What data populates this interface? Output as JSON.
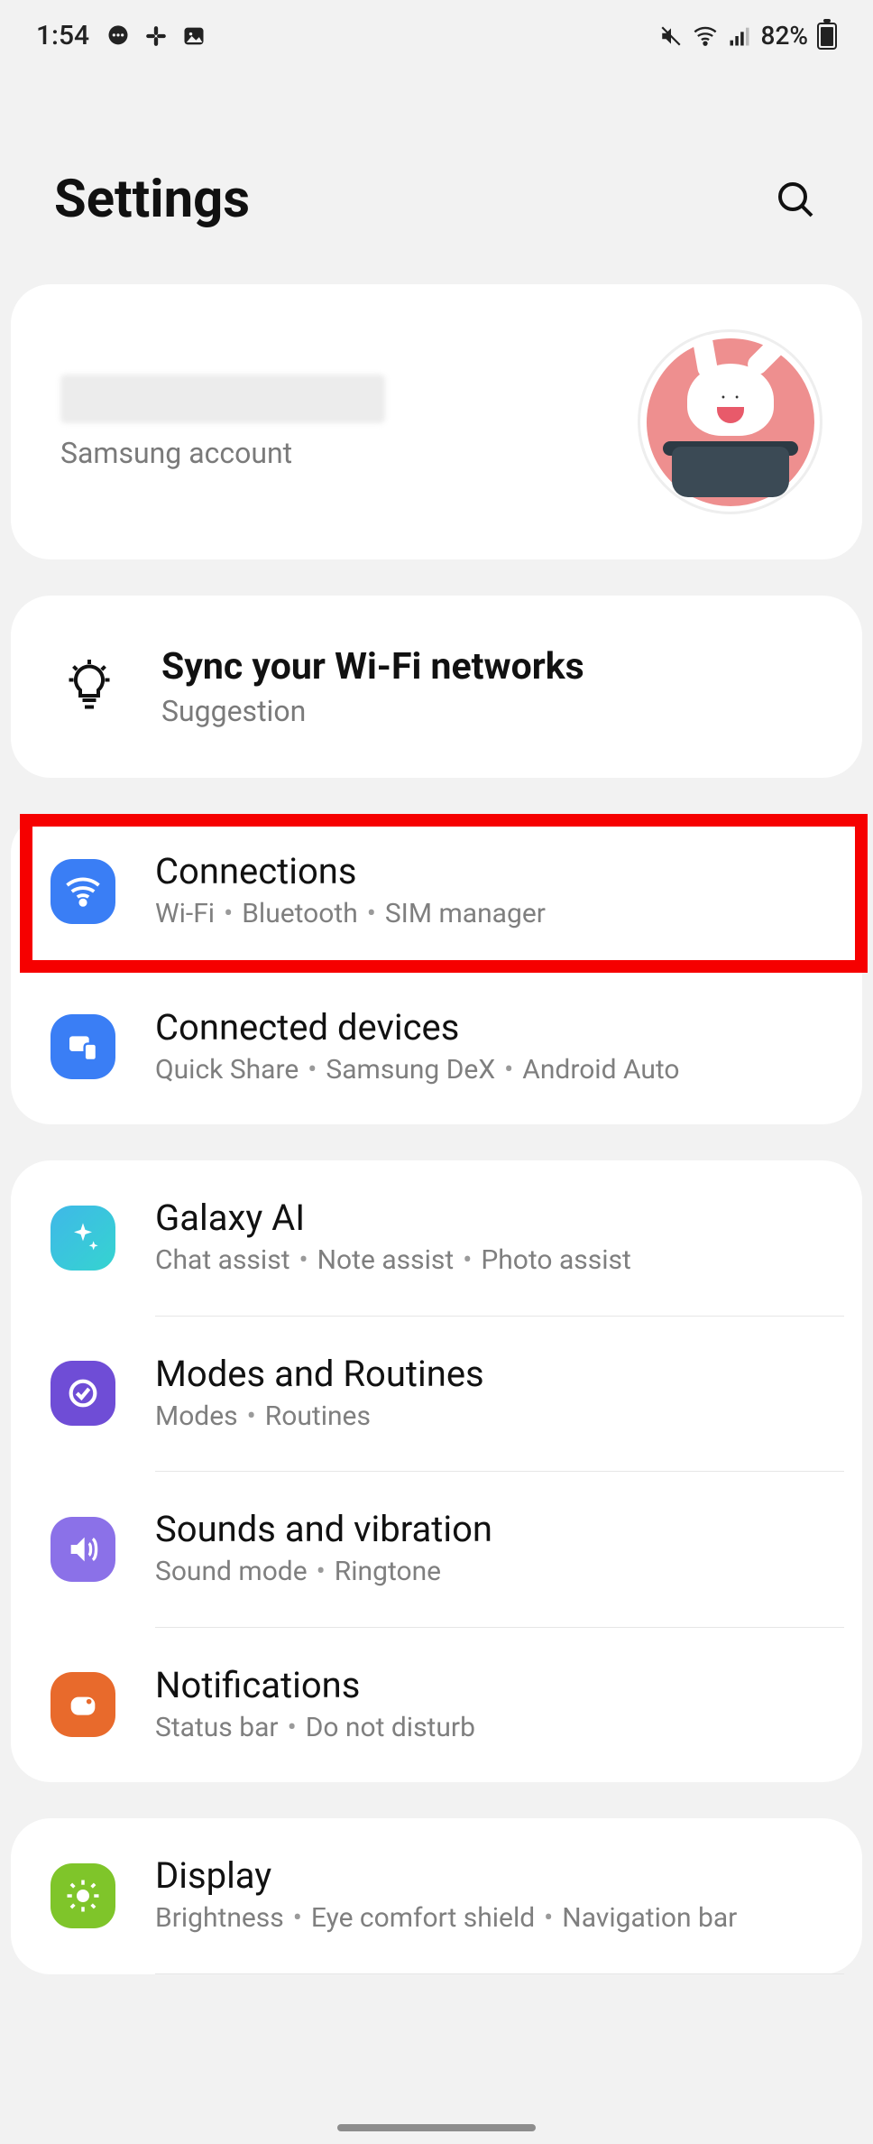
{
  "status": {
    "time": "1:54",
    "battery_pct": "82%"
  },
  "header": {
    "title": "Settings"
  },
  "account": {
    "sub": "Samsung account"
  },
  "suggestion": {
    "title": "Sync your Wi-Fi networks",
    "sub": "Suggestion"
  },
  "rows": {
    "connections": {
      "title": "Connections",
      "sub_parts": [
        "Wi-Fi",
        "Bluetooth",
        "SIM manager"
      ]
    },
    "connected_devices": {
      "title": "Connected devices",
      "sub_parts": [
        "Quick Share",
        "Samsung DeX",
        "Android Auto"
      ]
    },
    "galaxy_ai": {
      "title": "Galaxy AI",
      "sub_parts": [
        "Chat assist",
        "Note assist",
        "Photo assist"
      ]
    },
    "modes_routines": {
      "title": "Modes and Routines",
      "sub_parts": [
        "Modes",
        "Routines"
      ]
    },
    "sounds": {
      "title": "Sounds and vibration",
      "sub_parts": [
        "Sound mode",
        "Ringtone"
      ]
    },
    "notifications": {
      "title": "Notifications",
      "sub_parts": [
        "Status bar",
        "Do not disturb"
      ]
    },
    "display": {
      "title": "Display",
      "sub_parts": [
        "Brightness",
        "Eye comfort shield",
        "Navigation bar"
      ]
    }
  }
}
